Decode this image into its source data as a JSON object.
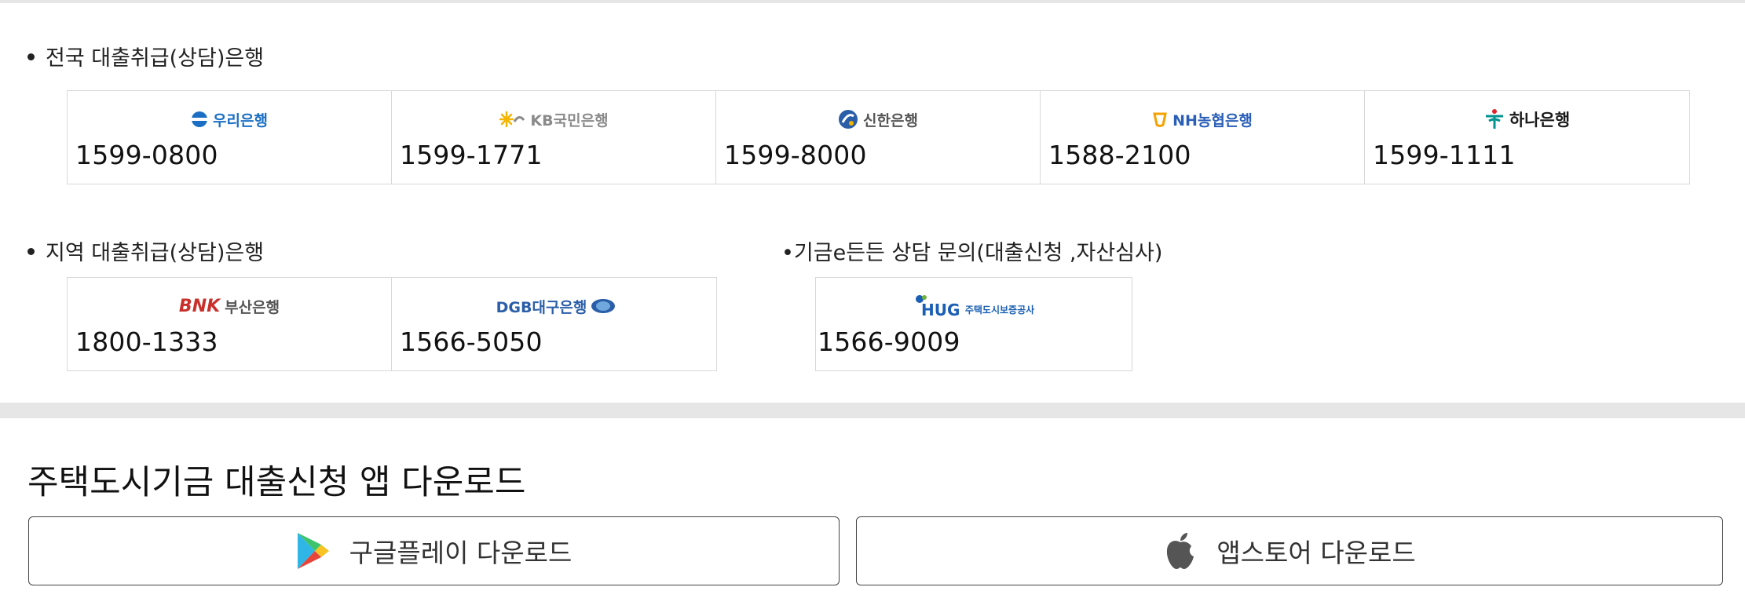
{
  "national": {
    "label": "전국 대출취급(상담)은행",
    "banks": [
      {
        "logo_text": "우리은행",
        "phone": "1599-0800",
        "color": "#1a6fc4"
      },
      {
        "logo_text": "KB국민은행",
        "phone": "1599-1771",
        "color": "#8a8a8a"
      },
      {
        "logo_text": "신한은행",
        "phone": "1599-8000",
        "color": "#2b5ea8"
      },
      {
        "logo_text": "NH농협은행",
        "phone": "1588-2100",
        "color": "#2a5fb8"
      },
      {
        "logo_text": "하나은행",
        "phone": "1599-1111",
        "color": "#1a1a1a"
      }
    ]
  },
  "regional": {
    "label": "지역 대출취급(상담)은행",
    "banks": [
      {
        "logo_text": "부산은행",
        "phone": "1800-1333",
        "color": "#c9302c"
      },
      {
        "logo_text": "DGB대구은행",
        "phone": "1566-5050",
        "color": "#2b5ea8"
      }
    ]
  },
  "hug": {
    "label": "•기금e든든 상담 문의(대출신청 ,자산심사)",
    "logo_text": "주택도시보증공사",
    "phone": "1566-9009",
    "color": "#1a5fb4"
  },
  "app": {
    "title": "주택도시기금 대출신청 앱 다운로드",
    "google_label": "구글플레이 다운로드",
    "apple_label": "앱스토어 다운로드"
  }
}
